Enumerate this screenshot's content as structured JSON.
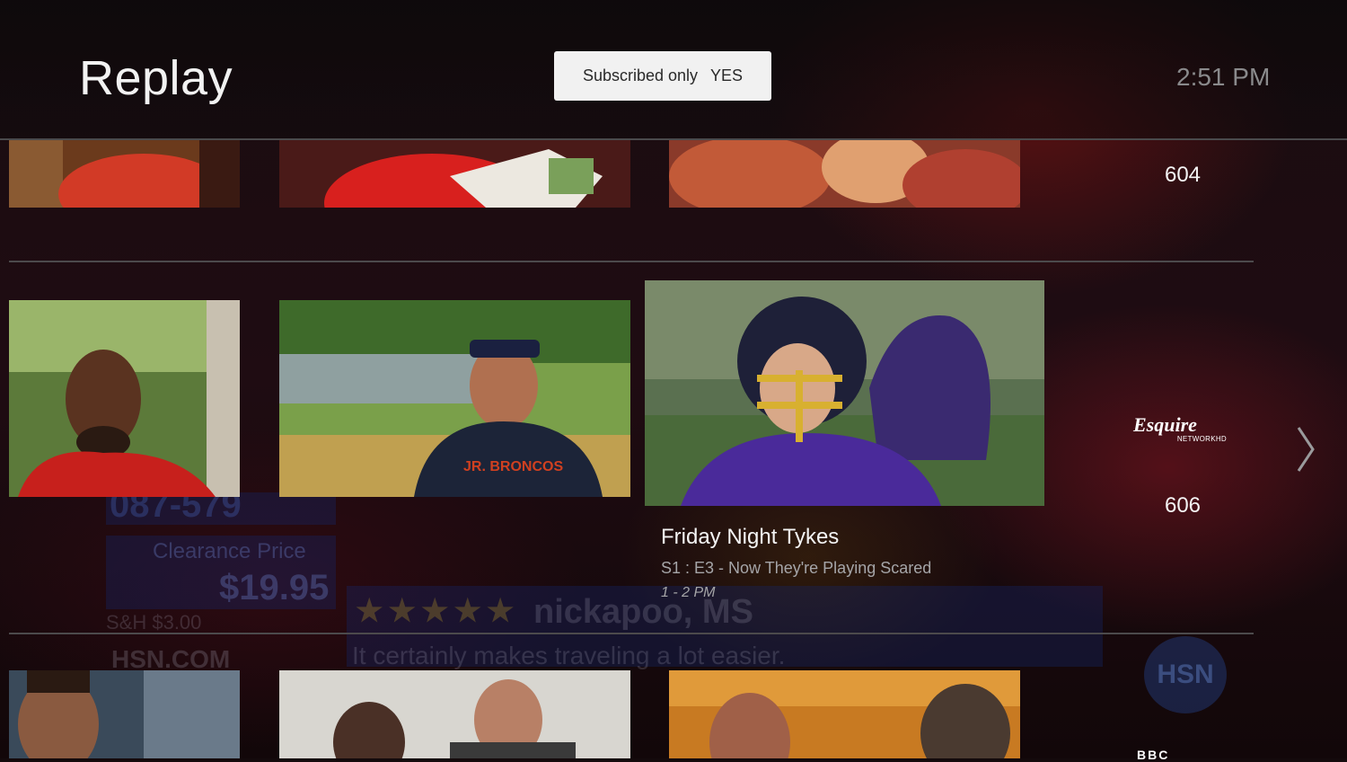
{
  "header": {
    "title": "Replay",
    "filter": {
      "label": "Subscribed only",
      "value": "YES"
    },
    "clock": "2:51 PM"
  },
  "background_ghost": {
    "number": "087-579",
    "clearance_label": "Clearance Price",
    "price": "$19.95",
    "shipping": "S&H $3.00",
    "site": "HSN.COM",
    "stars": "★★★★★",
    "reviewer": "nickapoo, MS",
    "quote": "It certainly makes traveling a lot easier.",
    "logo": "HSN"
  },
  "rows": [
    {
      "channel_number": "604",
      "tiles": [
        "thumbnail",
        "thumbnail",
        "thumbnail"
      ]
    },
    {
      "channel_number": "606",
      "channel_logo": {
        "main": "Esquire",
        "sub": "NETWORKHD"
      },
      "tiles": [
        "thumbnail",
        "thumbnail",
        "thumbnail-focused"
      ],
      "focused": {
        "title": "Friday Night Tykes",
        "episode": "S1 : E3 - Now They're Playing Scared",
        "time": "1 - 2 PM"
      }
    },
    {
      "channel_logo_partial": "BBC",
      "tiles": [
        "thumbnail",
        "thumbnail",
        "thumbnail"
      ]
    }
  ],
  "icons": {
    "next": "chevron-right-icon"
  },
  "colors": {
    "background": "#140a0c",
    "toggle_bg": "#f1f1f1",
    "divider": "#4c4a4c",
    "clock": "#8a8a8c"
  }
}
